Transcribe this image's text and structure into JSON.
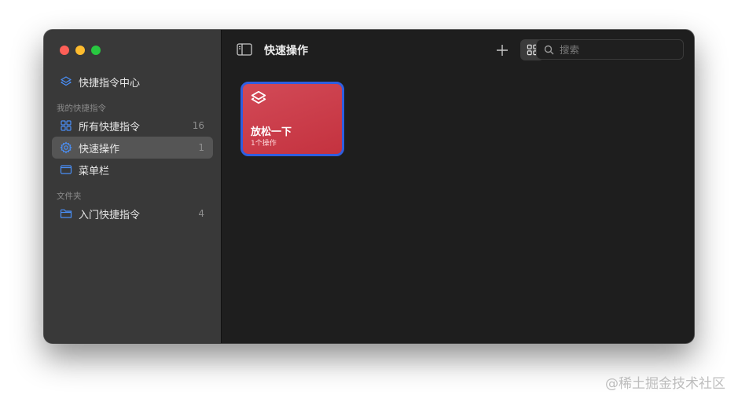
{
  "sidebar": {
    "header_item": {
      "label": "快捷指令中心",
      "icon": "layers-icon"
    },
    "sections": [
      {
        "label": "我的快捷指令",
        "items": [
          {
            "label": "所有快捷指令",
            "count": "16",
            "icon": "grid-icon"
          },
          {
            "label": "快速操作",
            "count": "1",
            "icon": "gear-icon",
            "selected": true
          },
          {
            "label": "菜单栏",
            "count": "",
            "icon": "menubar-icon"
          }
        ]
      },
      {
        "label": "文件夹",
        "items": [
          {
            "label": "入门快捷指令",
            "count": "4",
            "icon": "folder-icon"
          }
        ]
      }
    ]
  },
  "toolbar": {
    "title": "快速操作",
    "search_placeholder": "搜索",
    "view_mode": "grid"
  },
  "shortcut_card": {
    "title": "放松一下",
    "subtitle": "1个操作",
    "color": "#c93a47",
    "selected_border": "#2f5ee0"
  },
  "colors": {
    "accent": "#3b82f6",
    "sidebar_bg": "#393939",
    "main_bg": "#1e1e1e"
  },
  "watermark": "@稀土掘金技术社区"
}
